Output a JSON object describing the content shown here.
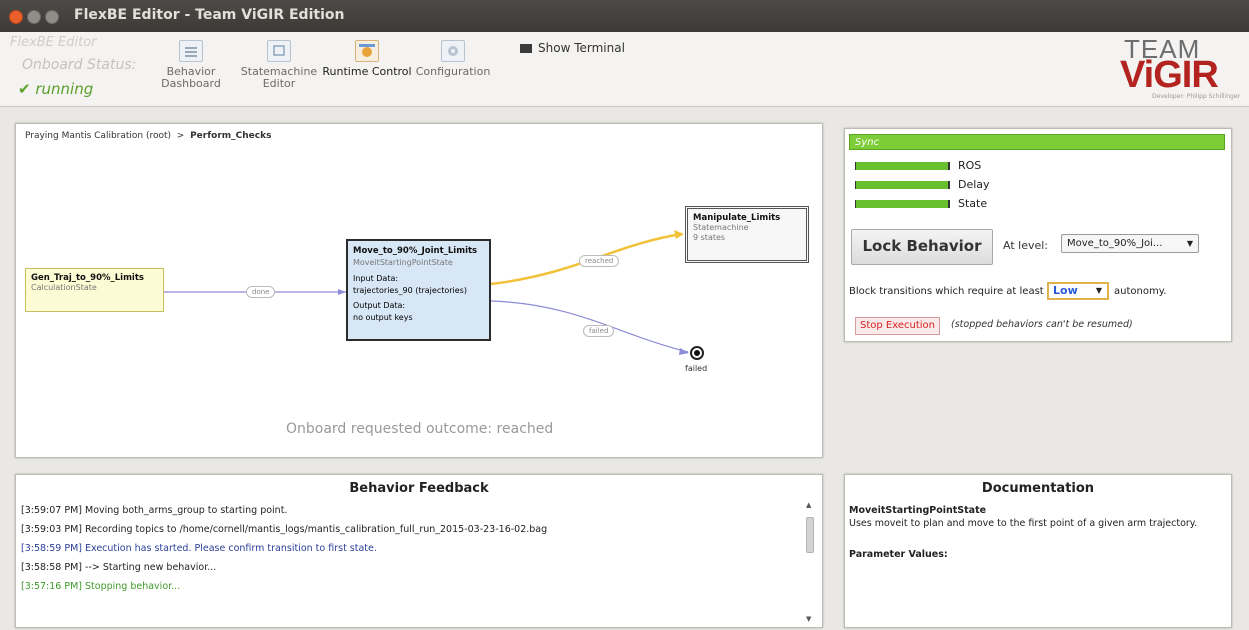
{
  "window": {
    "title": "FlexBE Editor - Team ViGIR Edition"
  },
  "toolbar": {
    "app_name": "FlexBE Editor",
    "onboard_status_label": "Onboard Status:",
    "onboard_status_value": "✔ running",
    "tabs": [
      {
        "label": "Behavior Dashboard",
        "active": false
      },
      {
        "label": "Statemachine Editor",
        "active": false
      },
      {
        "label": "Runtime Control",
        "active": true
      },
      {
        "label": "Configuration",
        "active": false
      }
    ],
    "show_terminal": "Show Terminal"
  },
  "logo": {
    "team": "TEAM",
    "name": "ViGIR",
    "developer": "Developer: Philipp Schillinger"
  },
  "graph": {
    "breadcrumb_root": "Praying Mantis Calibration (root)",
    "breadcrumb_sep": ">",
    "breadcrumb_current": "Perform_Checks",
    "nodes": {
      "gen": {
        "name": "Gen_Traj_to_90%_Limits",
        "class": "CalculationState"
      },
      "move": {
        "name": "Move_to_90%_Joint_Limits",
        "class": "MoveitStartingPointState",
        "input_label": "Input Data:",
        "input_value": "trajectories_90 (trajectories)",
        "output_label": "Output Data:",
        "output_value": "no output keys"
      },
      "manip": {
        "name": "Manipulate_Limits",
        "class": "Statemachine",
        "count": "9 states"
      }
    },
    "transitions": {
      "done": "done",
      "reached": "reached",
      "failed": "failed"
    },
    "final_outcome": "failed",
    "status": "Onboard requested outcome: reached"
  },
  "sync": {
    "header": "Sync",
    "rows": [
      "ROS",
      "Delay",
      "State"
    ],
    "lock_button": "Lock Behavior",
    "at_level_label": "At level:",
    "at_level_value": "Move_to_90%_Joi...",
    "block_text": "Block transitions which require at least",
    "autonomy_value": "Low",
    "autonomy_suffix": "autonomy.",
    "stop_button": "Stop Execution",
    "stop_note": "(stopped behaviors can't be resumed)"
  },
  "feedback": {
    "title": "Behavior Feedback",
    "lines": [
      {
        "text": "[3:59:07 PM] Moving both_arms_group to starting point.",
        "color": "#222222"
      },
      {
        "text": "[3:59:03 PM] Recording topics to /home/cornell/mantis_logs/mantis_calibration_full_run_2015-03-23-16-02.bag",
        "color": "#222222"
      },
      {
        "text": "[3:58:59 PM] Execution has started. Please confirm transition to first state.",
        "color": "#2b3f9a"
      },
      {
        "text": "[3:58:58 PM] --> Starting new behavior...",
        "color": "#222222"
      },
      {
        "text": "[3:57:16 PM] Stopping behavior...",
        "color": "#3f9a2b"
      }
    ]
  },
  "documentation": {
    "title": "Documentation",
    "state_name": "MoveitStartingPointState",
    "description": "Uses moveit to plan and move to the first point of a given arm trajectory.",
    "params_label": "Parameter Values:"
  }
}
